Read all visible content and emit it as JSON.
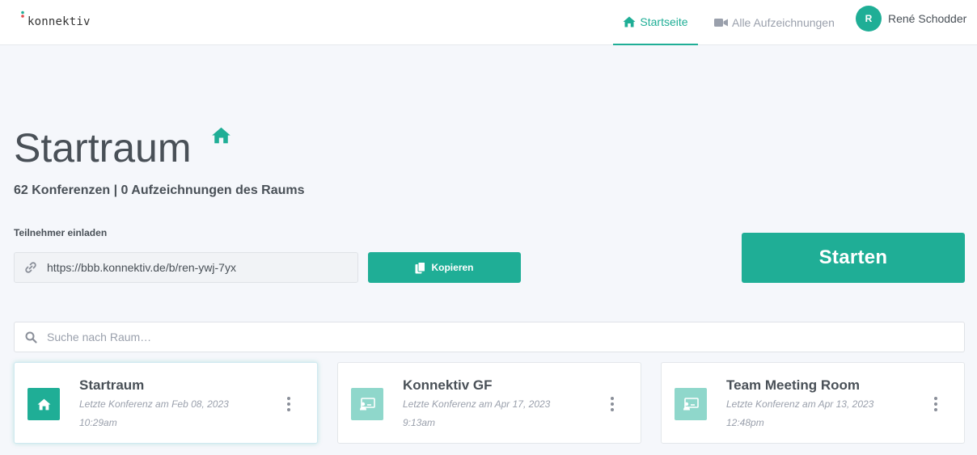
{
  "header": {
    "logo_text": "konnektiv",
    "nav": {
      "home_label": "Startseite",
      "recordings_label": "Alle Aufzeichnungen"
    },
    "user": {
      "initial": "R",
      "name": "René Schodder"
    }
  },
  "room": {
    "title": "Startraum",
    "stats": "62 Konferenzen | 0 Aufzeichnungen des Raums",
    "invite_label": "Teilnehmer einladen",
    "invite_url": "https://bbb.konnektiv.de/b/ren-ywj-7yx",
    "copy_label": "Kopieren",
    "start_label": "Starten"
  },
  "search": {
    "placeholder": "Suche nach Raum…"
  },
  "rooms": [
    {
      "name": "Startraum",
      "last_line1": "Letzte Konferenz am Feb 08, 2023",
      "last_line2": "10:29am",
      "icon": "home-icon"
    },
    {
      "name": "Konnektiv GF",
      "last_line1": "Letzte Konferenz am Apr 17, 2023",
      "last_line2": "9:13am",
      "icon": "presentation-icon"
    },
    {
      "name": "Team Meeting Room",
      "last_line1": "Letzte Konferenz am Apr 13, 2023",
      "last_line2": "12:48pm",
      "icon": "presentation-icon"
    }
  ],
  "colors": {
    "accent": "#1fae96",
    "accent_light": "#8fd7cb",
    "text": "#495057",
    "muted": "#9aa0ac",
    "background": "#f5f7fb"
  }
}
